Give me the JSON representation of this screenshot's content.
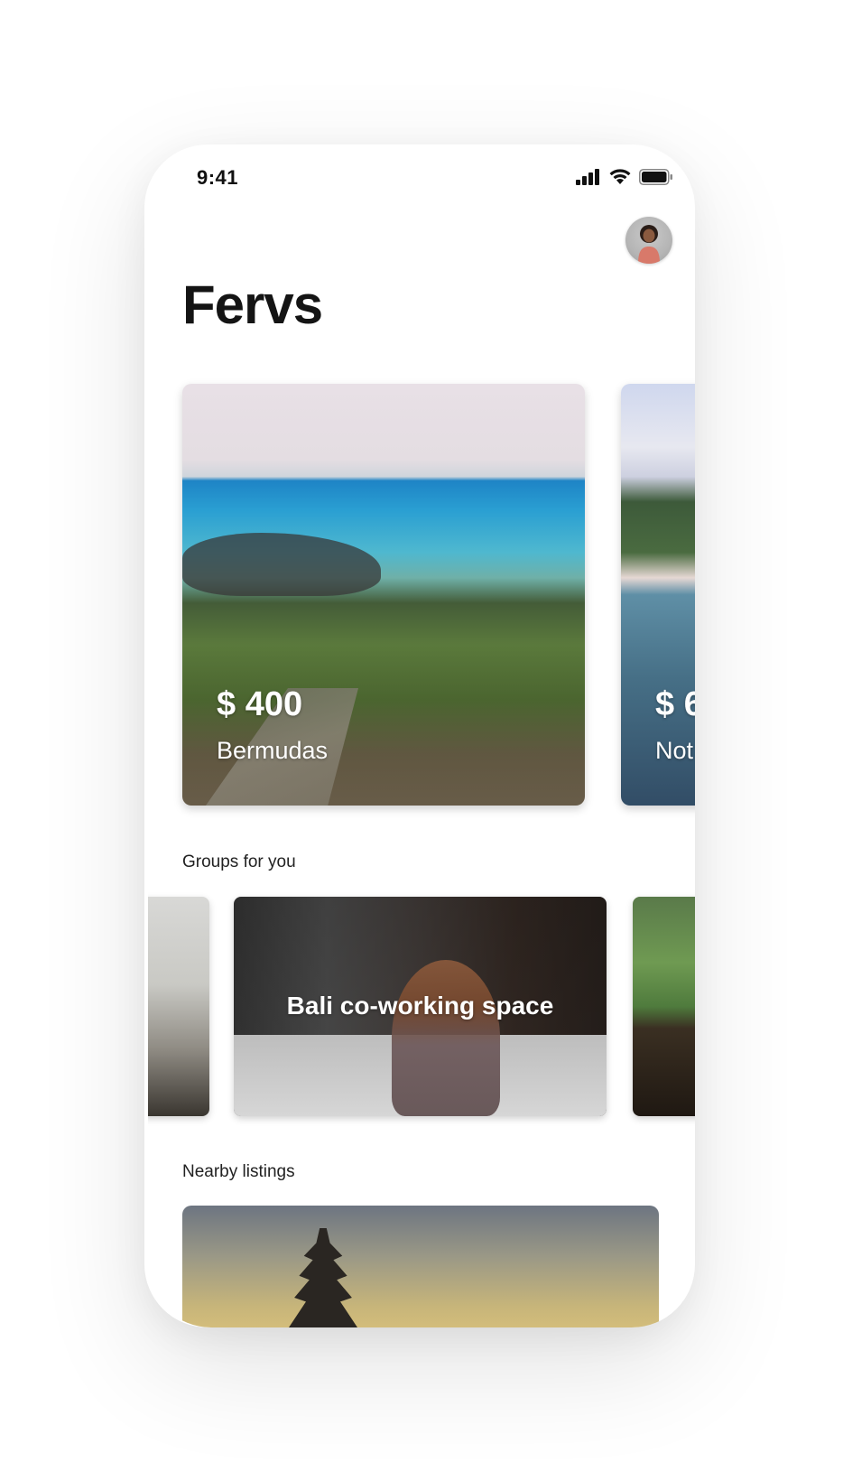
{
  "status_bar": {
    "time": "9:41",
    "signal_icon": "cellular-signal-icon",
    "wifi_icon": "wifi-icon",
    "battery_icon": "battery-icon"
  },
  "header": {
    "title": "Fervs",
    "avatar_icon": "user-avatar"
  },
  "destinations": [
    {
      "price": "$ 400",
      "name": "Bermudas"
    },
    {
      "price": "$ 6",
      "name": "Not"
    }
  ],
  "groups": {
    "section_label": "Groups for you",
    "items": [
      {
        "title": ""
      },
      {
        "title": "Bali co-working space"
      },
      {
        "title": ""
      }
    ]
  },
  "nearby": {
    "section_label": "Nearby listings"
  },
  "colors": {
    "background": "#ffffff",
    "title_text": "#141414",
    "card_text": "#ffffff"
  }
}
